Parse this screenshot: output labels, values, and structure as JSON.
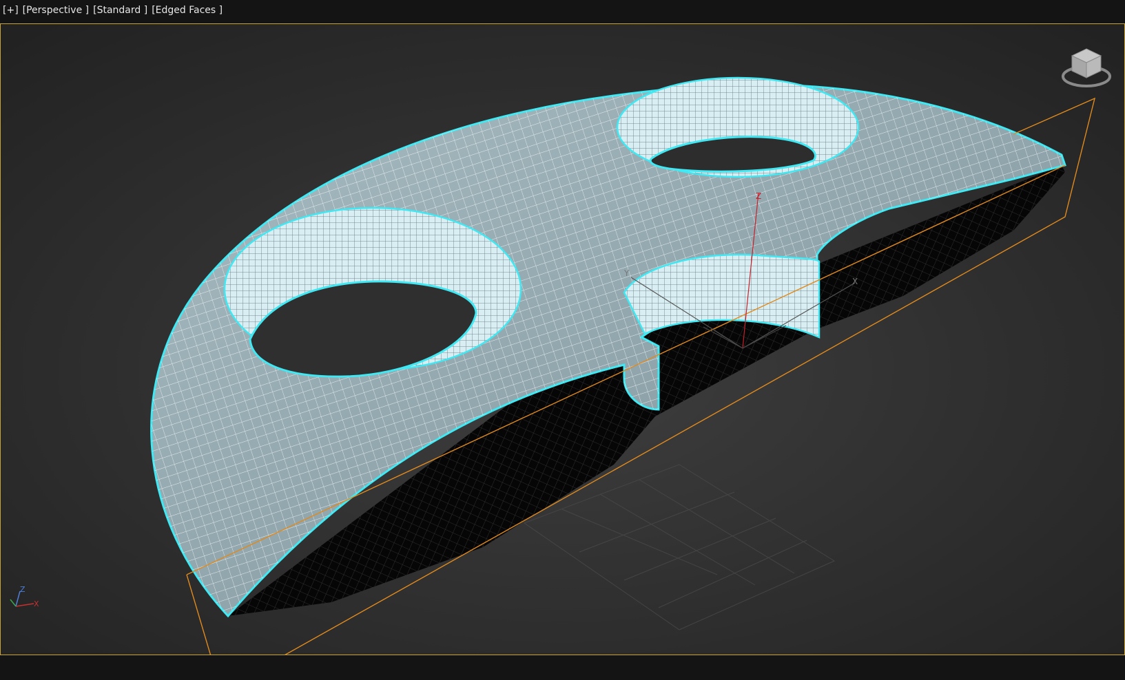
{
  "viewport": {
    "labels": {
      "plus": "[+]",
      "view": "[Perspective ]",
      "shading": "[Standard ]",
      "mode": "[Edged Faces ]"
    },
    "gizmo": {
      "x": "X",
      "y": "Y",
      "z": "Z"
    },
    "tripod": {
      "x": "X",
      "z": "Z"
    }
  },
  "colors": {
    "viewport_bg": "#2e2e2e",
    "border": "#c9a43a",
    "bbox_orange": "#e08a1e",
    "mesh_fill": "#8fa4ab",
    "mesh_wire": "#ffffff",
    "mesh_outline": "#3fe8f2"
  }
}
